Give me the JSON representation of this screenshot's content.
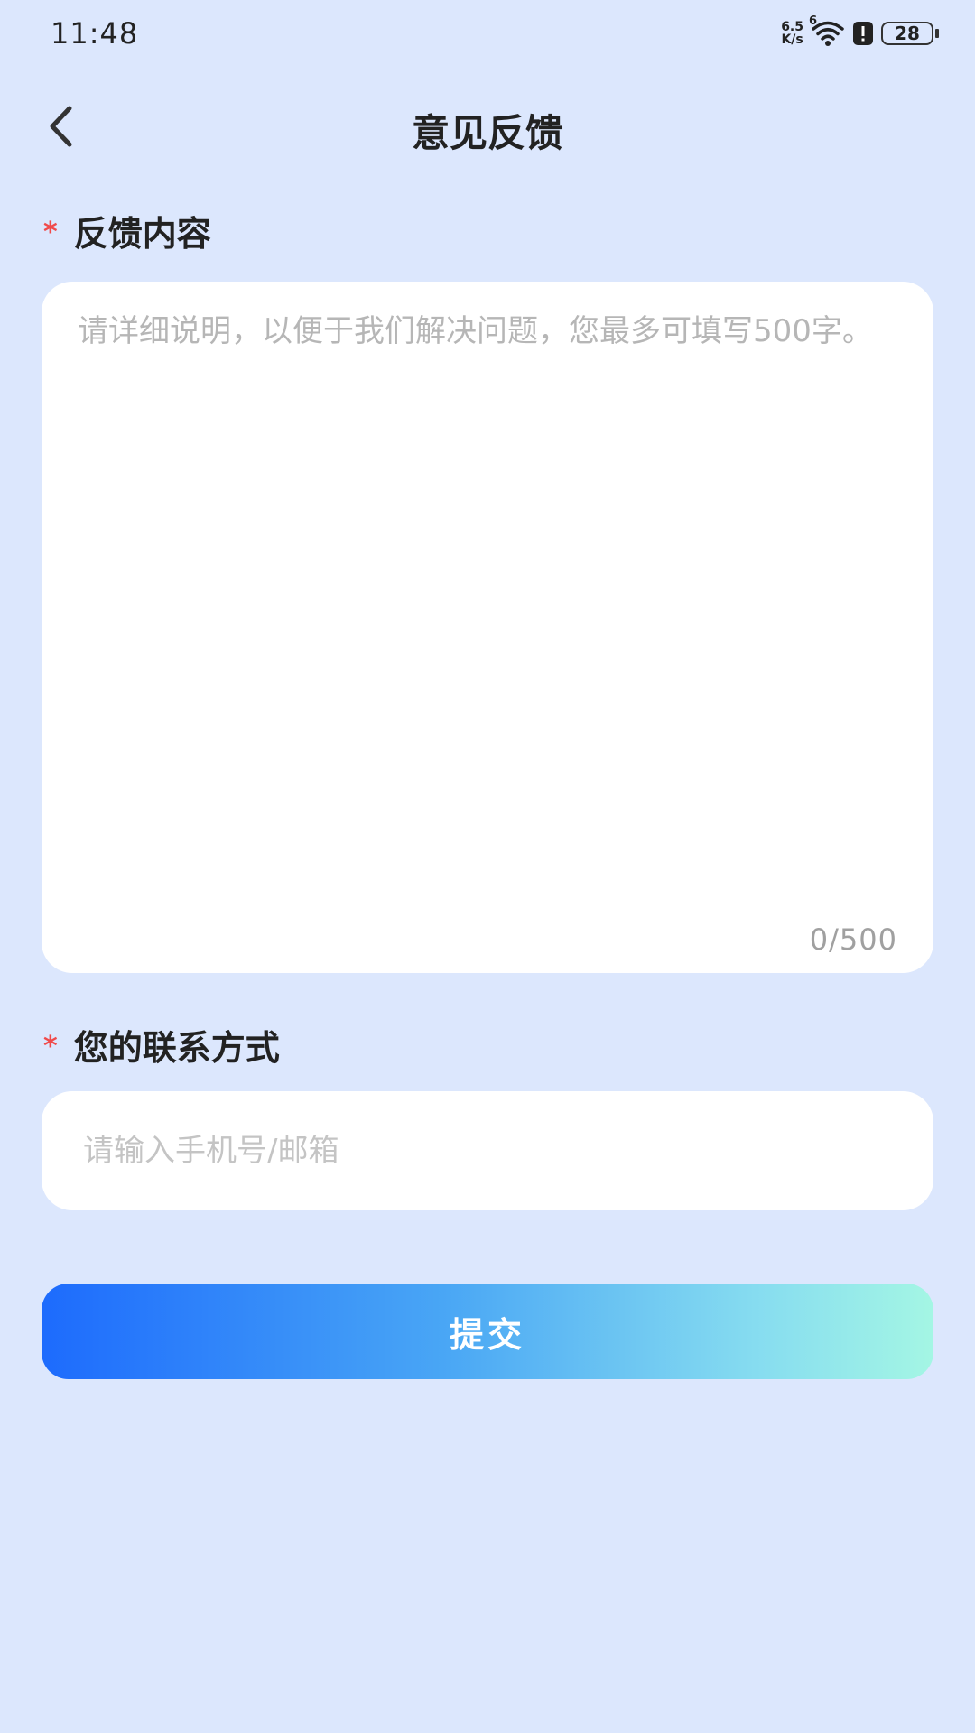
{
  "status_bar": {
    "time": "11:48",
    "net_speed_value": "6.5",
    "net_speed_unit": "K/s",
    "wifi_badge": "6",
    "battery_level": "28"
  },
  "header": {
    "title": "意见反馈"
  },
  "feedback": {
    "required_mark": "*",
    "label": "反馈内容",
    "placeholder": "请详细说明，以便于我们解决问题，您最多可填写500字。",
    "counter": "0/500"
  },
  "contact": {
    "required_mark": "*",
    "label": "您的联系方式",
    "placeholder": "请输入手机号/邮箱"
  },
  "submit": {
    "label": "提交"
  },
  "colors": {
    "background": "#dce7fd",
    "required": "#f04a4a",
    "gradient_start": "#1d6bfd",
    "gradient_end": "#a4f6e4"
  },
  "icons": {
    "back": "chevron-left-icon",
    "wifi": "wifi-icon",
    "alert": "alert-icon",
    "battery": "battery-icon"
  }
}
